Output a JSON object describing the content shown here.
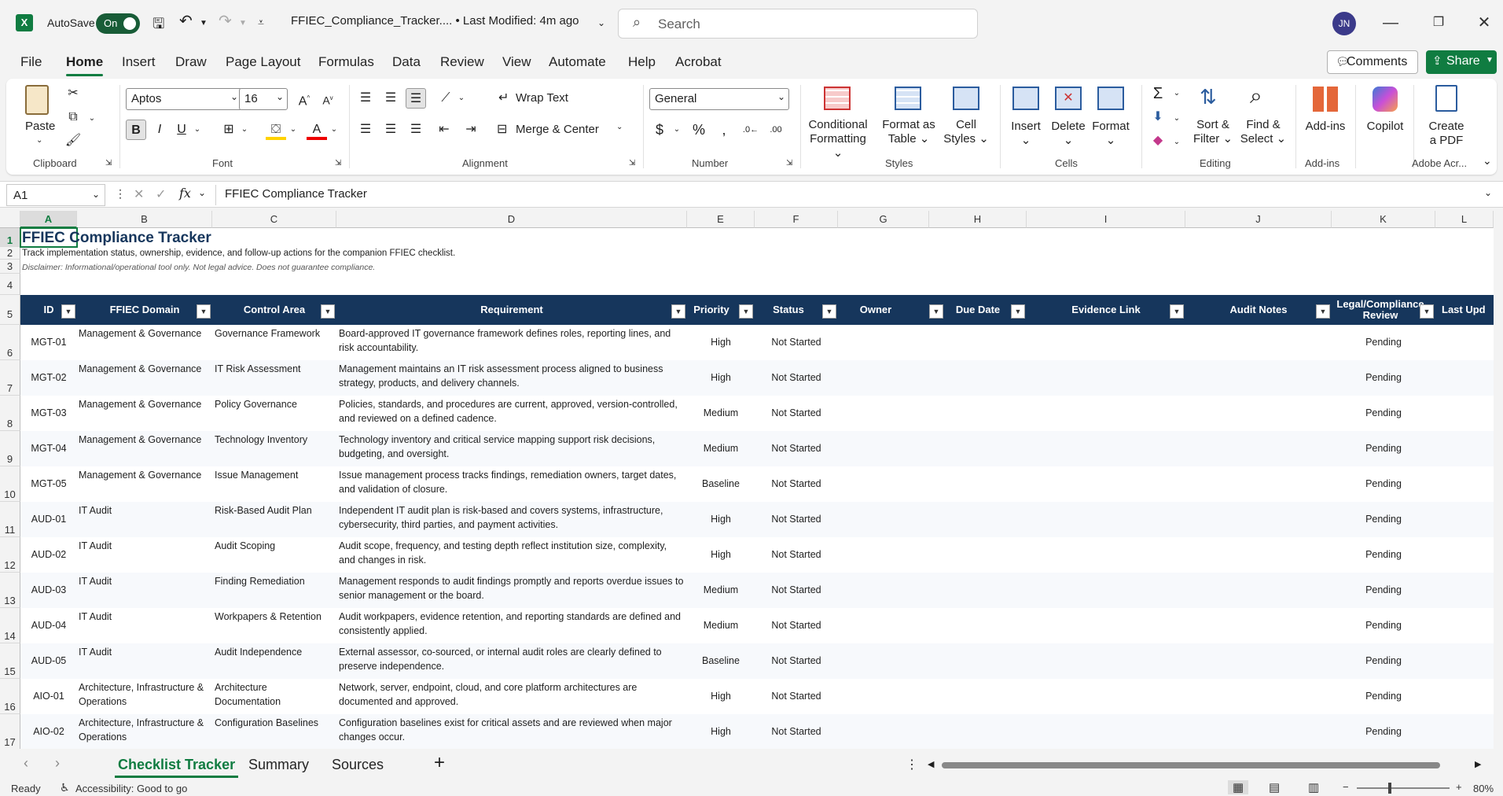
{
  "titlebar": {
    "autosave_label": "AutoSave",
    "autosave_state": "On",
    "doc_title": "FFIEC_Compliance_Tracker.... • Last Modified: 4m ago",
    "search_placeholder": "Search",
    "user_initials": "JN"
  },
  "menu": {
    "tabs": [
      "File",
      "Home",
      "Insert",
      "Draw",
      "Page Layout",
      "Formulas",
      "Data",
      "Review",
      "View",
      "Automate",
      "Help",
      "Acrobat"
    ],
    "comments": "Comments",
    "share": "Share"
  },
  "ribbon": {
    "clipboard": {
      "paste": "Paste",
      "label": "Clipboard"
    },
    "font": {
      "name": "Aptos",
      "size": "16",
      "label": "Font"
    },
    "alignment": {
      "wrap": "Wrap Text",
      "merge": "Merge & Center",
      "label": "Alignment"
    },
    "number": {
      "format": "General",
      "label": "Number"
    },
    "styles": {
      "cond1": "Conditional",
      "cond2": "Formatting",
      "fmt1": "Format as",
      "fmt2": "Table",
      "cell1": "Cell",
      "cell2": "Styles",
      "label": "Styles"
    },
    "cells": {
      "insert": "Insert",
      "delete": "Delete",
      "format": "Format",
      "label": "Cells"
    },
    "editing": {
      "sort1": "Sort &",
      "sort2": "Filter",
      "find1": "Find &",
      "find2": "Select",
      "label": "Editing"
    },
    "addins": {
      "btn": "Add-ins",
      "label": "Add-ins"
    },
    "copilot": {
      "btn": "Copilot"
    },
    "adobe": {
      "btn1": "Create",
      "btn2": "a PDF",
      "label": "Adobe Acr..."
    }
  },
  "formula_bar": {
    "name_box": "A1",
    "content": "FFIEC Compliance Tracker"
  },
  "columns": [
    "A",
    "B",
    "C",
    "D",
    "E",
    "F",
    "G",
    "H",
    "I",
    "J",
    "K",
    "L"
  ],
  "sheet": {
    "title": "FFIEC Compliance Tracker",
    "subtitle": "Track implementation status, ownership, evidence, and follow-up actions for the companion FFIEC checklist.",
    "disclaimer": "Disclaimer: Informational/operational tool only. Not legal advice. Does not guarantee compliance.",
    "headers": [
      "ID",
      "FFIEC Domain",
      "Control Area",
      "Requirement",
      "Priority",
      "Status",
      "Owner",
      "Due Date",
      "Evidence Link",
      "Audit Notes",
      "Legal/Compliance Review",
      "Last Upd"
    ],
    "rows": [
      {
        "num": "6",
        "id": "MGT-01",
        "domain": "Management & Governance",
        "area": "Governance Framework",
        "req": "Board-approved IT governance framework defines roles, reporting lines, and risk accountability.",
        "priority": "High",
        "status": "Not Started",
        "review": "Pending"
      },
      {
        "num": "7",
        "id": "MGT-02",
        "domain": "Management & Governance",
        "area": "IT Risk Assessment",
        "req": "Management maintains an IT risk assessment process aligned to business strategy, products, and delivery channels.",
        "priority": "High",
        "status": "Not Started",
        "review": "Pending"
      },
      {
        "num": "8",
        "id": "MGT-03",
        "domain": "Management & Governance",
        "area": "Policy Governance",
        "req": "Policies, standards, and procedures are current, approved, version-controlled, and reviewed on a defined cadence.",
        "priority": "Medium",
        "status": "Not Started",
        "review": "Pending"
      },
      {
        "num": "9",
        "id": "MGT-04",
        "domain": "Management & Governance",
        "area": "Technology Inventory",
        "req": "Technology inventory and critical service mapping support risk decisions, budgeting, and oversight.",
        "priority": "Medium",
        "status": "Not Started",
        "review": "Pending"
      },
      {
        "num": "10",
        "id": "MGT-05",
        "domain": "Management & Governance",
        "area": "Issue Management",
        "req": "Issue management process tracks findings, remediation owners, target dates, and validation of closure.",
        "priority": "Baseline",
        "status": "Not Started",
        "review": "Pending"
      },
      {
        "num": "11",
        "id": "AUD-01",
        "domain": "IT Audit",
        "area": "Risk-Based Audit Plan",
        "req": "Independent IT audit plan is risk-based and covers systems, infrastructure, cybersecurity, third parties, and payment activities.",
        "priority": "High",
        "status": "Not Started",
        "review": "Pending"
      },
      {
        "num": "12",
        "id": "AUD-02",
        "domain": "IT Audit",
        "area": "Audit Scoping",
        "req": "Audit scope, frequency, and testing depth reflect institution size, complexity, and changes in risk.",
        "priority": "High",
        "status": "Not Started",
        "review": "Pending"
      },
      {
        "num": "13",
        "id": "AUD-03",
        "domain": "IT Audit",
        "area": "Finding Remediation",
        "req": "Management responds to audit findings promptly and reports overdue issues to senior management or the board.",
        "priority": "Medium",
        "status": "Not Started",
        "review": "Pending"
      },
      {
        "num": "14",
        "id": "AUD-04",
        "domain": "IT Audit",
        "area": "Workpapers & Retention",
        "req": "Audit workpapers, evidence retention, and reporting standards are defined and consistently applied.",
        "priority": "Medium",
        "status": "Not Started",
        "review": "Pending"
      },
      {
        "num": "15",
        "id": "AUD-05",
        "domain": "IT Audit",
        "area": "Audit Independence",
        "req": "External assessor, co-sourced, or internal audit roles are clearly defined to preserve independence.",
        "priority": "Baseline",
        "status": "Not Started",
        "review": "Pending"
      },
      {
        "num": "16",
        "id": "AIO-01",
        "domain": "Architecture, Infrastructure & Operations",
        "area": "Architecture Documentation",
        "req": "Network, server, endpoint, cloud, and core platform architectures are documented and approved.",
        "priority": "High",
        "status": "Not Started",
        "review": "Pending"
      },
      {
        "num": "17",
        "id": "AIO-02",
        "domain": "Architecture, Infrastructure & Operations",
        "area": "Configuration Baselines",
        "req": "Configuration baselines exist for critical assets and are reviewed when major changes occur.",
        "priority": "High",
        "status": "Not Started",
        "review": "Pending"
      }
    ]
  },
  "sheet_tabs": [
    "Checklist Tracker",
    "Summary",
    "Sources"
  ],
  "status": {
    "ready": "Ready",
    "accessibility": "Accessibility: Good to go",
    "zoom": "80%"
  }
}
